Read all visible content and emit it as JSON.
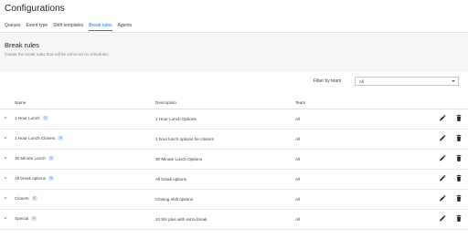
{
  "page": {
    "title": "Configurations"
  },
  "tabs": [
    {
      "label": "Queues",
      "active": false
    },
    {
      "label": "Event type",
      "active": false
    },
    {
      "label": "Shift templates",
      "active": false
    },
    {
      "label": "Break rules",
      "active": true
    },
    {
      "label": "Agents",
      "active": false
    }
  ],
  "section": {
    "title": "Break rules",
    "subtitle": "Create the break rules that will be enforced on schedules"
  },
  "filter": {
    "label": "Filter by team",
    "value": "All"
  },
  "table": {
    "headers": {
      "name": "Name",
      "description": "Description",
      "team": "Team"
    },
    "rows": [
      {
        "name": "1 Hour Lunch",
        "count": "1",
        "description": "1 Hour Lunch Options",
        "team": "All"
      },
      {
        "name": "1 Hour Lunch Closers",
        "count": "1",
        "description": "1 hour lunch options for closers",
        "team": "All"
      },
      {
        "name": "30 Minute Lunch",
        "count": "1",
        "description": "30 Minute Lunch Options",
        "team": "All"
      },
      {
        "name": "All break options",
        "count": "3",
        "description": "All break options",
        "team": "All"
      },
      {
        "name": "Closers",
        "count": "1",
        "description": "Closing shift options",
        "team": "All"
      },
      {
        "name": "Special",
        "count": "1",
        "description": "10.5hr plus with extra break",
        "team": "All"
      }
    ]
  },
  "colors": {
    "accent": "#1a73e8",
    "badge_bg": "#d2e3fc",
    "section_bg": "#f5f6f7"
  },
  "icons": {
    "expand": "chevron-down-icon",
    "edit": "pencil-icon",
    "delete": "trash-icon",
    "dropdown": "caret-down-icon"
  }
}
